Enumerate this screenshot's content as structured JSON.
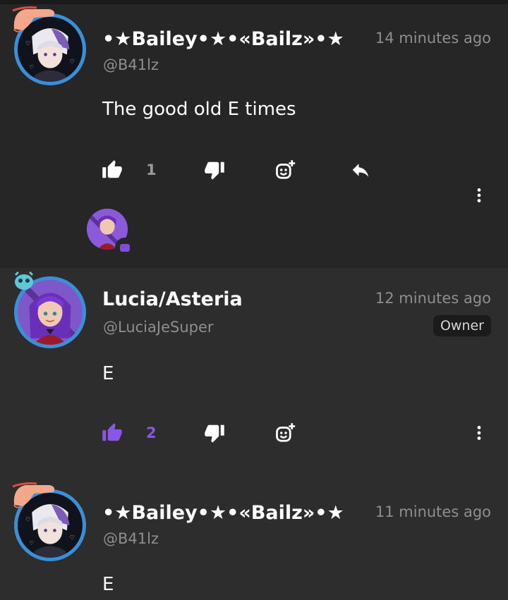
{
  "comments": [
    {
      "username": "•★Bailey•★•«Bailz»•★",
      "handle": "@B41lz",
      "time": "14 minutes ago",
      "text": "The good old E times",
      "likes": "1",
      "liked": false,
      "has_reply_button": true,
      "has_reply_preview": true
    },
    {
      "username": "Lucia/Asteria",
      "handle": "@LuciaJeSuper",
      "time": "12 minutes ago",
      "badge": "Owner",
      "text": "E",
      "likes": "2",
      "liked": true,
      "has_reply_button": false
    },
    {
      "username": "•★Bailey•★•«Bailz»•★",
      "handle": "@B41lz",
      "time": "11 minutes ago",
      "text": "E"
    }
  ],
  "colors": {
    "accent": "#8b55e6",
    "avatar_ring": "#3b8fd9",
    "muted_text": "#8e8e8e",
    "background": "#262626"
  },
  "icons": {
    "like": "thumbs-up-icon",
    "dislike": "thumbs-down-icon",
    "react": "add-reaction-icon",
    "reply": "reply-arrow-icon",
    "more": "more-vertical-icon"
  }
}
